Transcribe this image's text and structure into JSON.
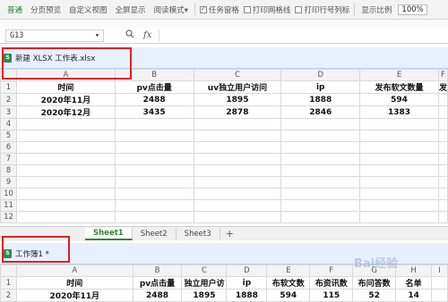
{
  "toolbar": {
    "items": [
      "普通",
      "分页预览",
      "自定义视图",
      "全屏显示",
      "阅读模式"
    ],
    "read_mode_arrow": "▾",
    "checkboxes": [
      {
        "label": "任务窗格",
        "checked": true
      },
      {
        "label": "打印网格线",
        "checked": false
      },
      {
        "label": "打印行号列标",
        "checked": false
      }
    ],
    "zoom_label": "显示比例",
    "zoom_value": "100%"
  },
  "formula_bar": {
    "cell_ref": "G13",
    "fx_label": "fx"
  },
  "window1": {
    "title": "新建 XLSX 工作表.xlsx",
    "column_headers": [
      "A",
      "B",
      "C",
      "D",
      "E",
      "F"
    ],
    "rows": [
      {
        "num": "1",
        "cells": [
          "时间",
          "pv点击量",
          "uv独立用户访问",
          "ip",
          "发布软文数量",
          "发"
        ]
      },
      {
        "num": "2",
        "cells": [
          "2020年11月",
          "2488",
          "1895",
          "1888",
          "594",
          ""
        ]
      },
      {
        "num": "3",
        "cells": [
          "2020年12月",
          "3435",
          "2878",
          "2846",
          "1383",
          ""
        ]
      },
      {
        "num": "4",
        "cells": [
          "",
          "",
          "",
          "",
          "",
          ""
        ]
      },
      {
        "num": "5",
        "cells": [
          "",
          "",
          "",
          "",
          "",
          ""
        ]
      },
      {
        "num": "6",
        "cells": [
          "",
          "",
          "",
          "",
          "",
          ""
        ]
      },
      {
        "num": "7",
        "cells": [
          "",
          "",
          "",
          "",
          "",
          ""
        ]
      },
      {
        "num": "8",
        "cells": [
          "",
          "",
          "",
          "",
          "",
          ""
        ]
      },
      {
        "num": "9",
        "cells": [
          "",
          "",
          "",
          "",
          "",
          ""
        ]
      },
      {
        "num": "10",
        "cells": [
          "",
          "",
          "",
          "",
          "",
          ""
        ]
      },
      {
        "num": "11",
        "cells": [
          "",
          "",
          "",
          "",
          "",
          ""
        ]
      },
      {
        "num": "12",
        "cells": [
          "",
          "",
          "",
          "",
          "",
          ""
        ]
      }
    ],
    "sheet_tabs": [
      "Sheet1",
      "Sheet2",
      "Sheet3"
    ],
    "active_sheet": "Sheet1",
    "add_sheet": "+"
  },
  "window2": {
    "title": "工作簿1 *",
    "column_headers": [
      "A",
      "B",
      "C",
      "D",
      "E",
      "F",
      "G",
      "H",
      "I"
    ],
    "rows": [
      {
        "num": "1",
        "cells": [
          "时间",
          "pv点击量",
          "独立用户访",
          "ip",
          "布软文数",
          "布资讯数",
          "布问答数",
          "名单",
          ""
        ]
      },
      {
        "num": "2",
        "cells": [
          "2020年11月",
          "2488",
          "1895",
          "1888",
          "594",
          "115",
          "52",
          "14",
          ""
        ]
      }
    ]
  },
  "watermark": "Bai经验"
}
